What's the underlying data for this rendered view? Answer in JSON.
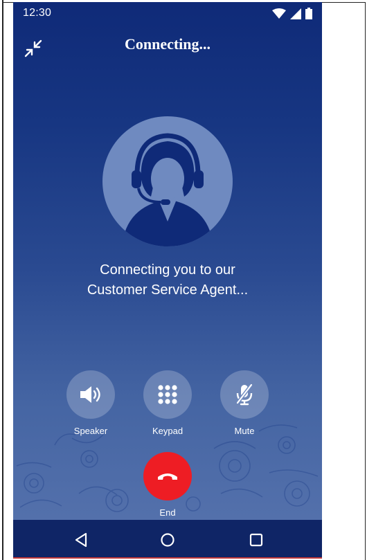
{
  "status_bar": {
    "time": "12:30",
    "icons": [
      "wifi-icon",
      "cellular-signal-icon",
      "battery-icon"
    ]
  },
  "header": {
    "title": "Connecting...",
    "collapse_icon": "minimize-arrows-icon"
  },
  "avatar": {
    "icon": "headset-agent-icon"
  },
  "message": {
    "line1": "Connecting you to our",
    "line2": "Customer Service Agent..."
  },
  "controls": {
    "speaker": {
      "label": "Speaker",
      "icon": "speaker-icon"
    },
    "keypad": {
      "label": "Keypad",
      "icon": "keypad-icon"
    },
    "mute": {
      "label": "Mute",
      "icon": "mic-off-icon"
    }
  },
  "end_call": {
    "label": "End",
    "icon": "hang-up-icon",
    "color": "#ee1d24"
  },
  "nav": {
    "back_icon": "back-triangle-icon",
    "home_icon": "home-circle-icon",
    "recents_icon": "recents-square-icon"
  },
  "colors": {
    "background_top": "#0f2a78",
    "background_bottom": "#5874ae",
    "nav_bar": "#0f2566",
    "avatar_circle": "#6f8ac0",
    "end_button": "#ee1d24"
  }
}
